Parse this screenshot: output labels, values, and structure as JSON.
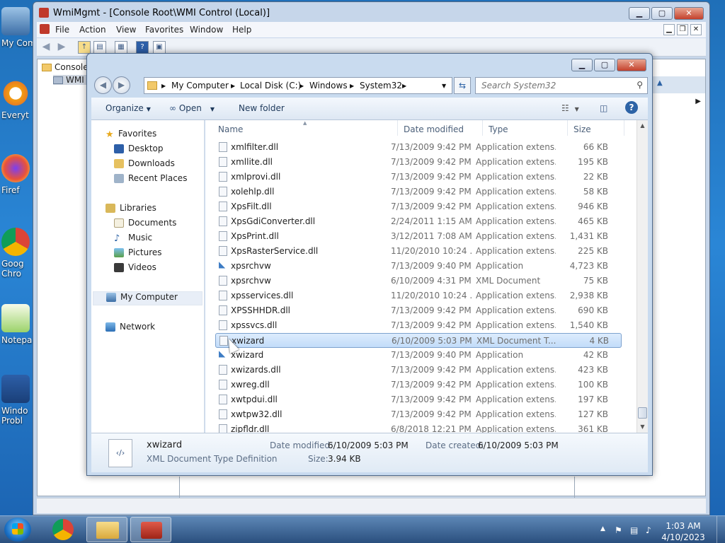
{
  "desktop": {
    "icons": [
      {
        "label": "My Com"
      },
      {
        "label": "Everyt"
      },
      {
        "label": "Firef"
      },
      {
        "label": "Goog\nChro"
      },
      {
        "label": "Notepa"
      },
      {
        "label": "Windo\nProbl"
      }
    ]
  },
  "mmc": {
    "title": "WmiMgmt - [Console Root\\WMI Control (Local)]",
    "menu": [
      "File",
      "Action",
      "View",
      "Favorites",
      "Window",
      "Help"
    ],
    "tree": [
      {
        "label": "Console"
      },
      {
        "label": "WMI"
      }
    ]
  },
  "explorer": {
    "breadcrumb": [
      "My Computer",
      "Local Disk (C:)",
      "Windows",
      "System32"
    ],
    "search_placeholder": "Search System32",
    "toolbar": {
      "organize": "Organize",
      "open": "Open",
      "new_folder": "New folder"
    },
    "nav": {
      "favorites": "Favorites",
      "favorites_items": [
        "Desktop",
        "Downloads",
        "Recent Places"
      ],
      "libraries": "Libraries",
      "libraries_items": [
        "Documents",
        "Music",
        "Pictures",
        "Videos"
      ],
      "my_computer": "My Computer",
      "network": "Network"
    },
    "columns": {
      "name": "Name",
      "date": "Date modified",
      "type": "Type",
      "size": "Size"
    },
    "files": [
      {
        "name": "xmlfilter.dll",
        "date": "7/13/2009 9:42 PM",
        "type": "Application extens...",
        "size": "66 KB",
        "kind": "dll"
      },
      {
        "name": "xmllite.dll",
        "date": "7/13/2009 9:42 PM",
        "type": "Application extens...",
        "size": "195 KB",
        "kind": "dll"
      },
      {
        "name": "xmlprovi.dll",
        "date": "7/13/2009 9:42 PM",
        "type": "Application extens...",
        "size": "22 KB",
        "kind": "dll"
      },
      {
        "name": "xolehlp.dll",
        "date": "7/13/2009 9:42 PM",
        "type": "Application extens...",
        "size": "58 KB",
        "kind": "dll"
      },
      {
        "name": "XpsFilt.dll",
        "date": "7/13/2009 9:42 PM",
        "type": "Application extens...",
        "size": "946 KB",
        "kind": "dll"
      },
      {
        "name": "XpsGdiConverter.dll",
        "date": "2/24/2011 1:15 AM",
        "type": "Application extens...",
        "size": "465 KB",
        "kind": "dll"
      },
      {
        "name": "XpsPrint.dll",
        "date": "3/12/2011 7:08 AM",
        "type": "Application extens...",
        "size": "1,431 KB",
        "kind": "dll"
      },
      {
        "name": "XpsRasterService.dll",
        "date": "11/20/2010 10:24 ...",
        "type": "Application extens...",
        "size": "225 KB",
        "kind": "dll"
      },
      {
        "name": "xpsrchvw",
        "date": "7/13/2009 9:40 PM",
        "type": "Application",
        "size": "4,723 KB",
        "kind": "exe"
      },
      {
        "name": "xpsrchvw",
        "date": "6/10/2009 4:31 PM",
        "type": "XML Document",
        "size": "75 KB",
        "kind": "xml"
      },
      {
        "name": "xpsservices.dll",
        "date": "11/20/2010 10:24 ...",
        "type": "Application extens...",
        "size": "2,938 KB",
        "kind": "dll"
      },
      {
        "name": "XPSSHHDR.dll",
        "date": "7/13/2009 9:42 PM",
        "type": "Application extens...",
        "size": "690 KB",
        "kind": "dll"
      },
      {
        "name": "xpssvcs.dll",
        "date": "7/13/2009 9:42 PM",
        "type": "Application extens...",
        "size": "1,540 KB",
        "kind": "dll"
      },
      {
        "name": "xwizard",
        "date": "6/10/2009 5:03 PM",
        "type": "XML Document T...",
        "size": "4 KB",
        "kind": "xml"
      },
      {
        "name": "xwizard",
        "date": "7/13/2009 9:40 PM",
        "type": "Application",
        "size": "42 KB",
        "kind": "exe"
      },
      {
        "name": "xwizards.dll",
        "date": "7/13/2009 9:42 PM",
        "type": "Application extens...",
        "size": "423 KB",
        "kind": "dll"
      },
      {
        "name": "xwreg.dll",
        "date": "7/13/2009 9:42 PM",
        "type": "Application extens...",
        "size": "100 KB",
        "kind": "dll"
      },
      {
        "name": "xwtpdui.dll",
        "date": "7/13/2009 9:42 PM",
        "type": "Application extens...",
        "size": "197 KB",
        "kind": "dll"
      },
      {
        "name": "xwtpw32.dll",
        "date": "7/13/2009 9:42 PM",
        "type": "Application extens...",
        "size": "127 KB",
        "kind": "dll"
      },
      {
        "name": "zipfldr.dll",
        "date": "6/8/2018 12:21 PM",
        "type": "Application extens...",
        "size": "361 KB",
        "kind": "dll"
      }
    ],
    "selected_index": 13,
    "details": {
      "name": "xwizard",
      "type": "XML Document Type Definition",
      "modified_label": "Date modified:",
      "modified": "6/10/2009 5:03 PM",
      "created_label": "Date created:",
      "created": "6/10/2009 5:03 PM",
      "size_label": "Size:",
      "size": "3.94 KB"
    }
  },
  "taskbar": {
    "time": "1:03 AM",
    "date": "4/10/2023"
  },
  "colors": {
    "selection": "#c2dcf9",
    "accent": "#2d63a6"
  }
}
